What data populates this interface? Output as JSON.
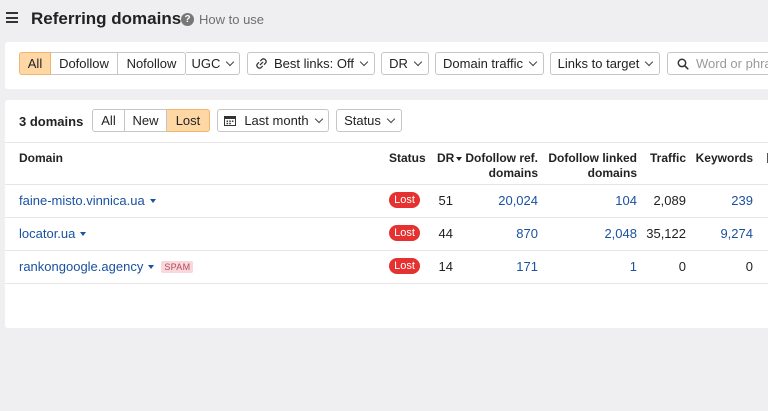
{
  "header": {
    "title": "Referring domains",
    "help_label": "How to use",
    "help_icon_glyph": "?"
  },
  "filters": {
    "link_type_tabs": [
      "All",
      "Dofollow",
      "Nofollow"
    ],
    "active_link_type": "All",
    "ugc_label": "UGC",
    "best_links_label": "Best links: Off",
    "dr_label": "DR",
    "domain_traffic_label": "Domain traffic",
    "links_to_target_label": "Links to target",
    "search_placeholder": "Word or phra"
  },
  "panel": {
    "count_label": "3 domains",
    "status_tabs": [
      "All",
      "New",
      "Lost"
    ],
    "active_status_tab": "Lost",
    "period_label": "Last month",
    "status_filter_label": "Status"
  },
  "table": {
    "columns": {
      "domain": "Domain",
      "status": "Status",
      "dr": "DR",
      "dofollow_ref_line1": "Dofollow ref.",
      "dofollow_ref_line2": "domains",
      "dofollow_linked_line1": "Dofollow linked",
      "dofollow_linked_line2": "domains",
      "traffic": "Traffic",
      "keywords": "Keywords"
    },
    "rows": [
      {
        "domain": "faine-misto.vinnica.ua",
        "spam": "",
        "status": "Lost",
        "dr": "51",
        "dofollow_ref": "20,024",
        "dofollow_linked": "104",
        "traffic": "2,089",
        "keywords": "239"
      },
      {
        "domain": "locator.ua",
        "spam": "",
        "status": "Lost",
        "dr": "44",
        "dofollow_ref": "870",
        "dofollow_linked": "2,048",
        "traffic": "35,122",
        "keywords": "9,274"
      },
      {
        "domain": "rankongoogle.agency",
        "spam": "SPAM",
        "status": "Lost",
        "dr": "14",
        "dofollow_ref": "171",
        "dofollow_linked": "1",
        "traffic": "0",
        "keywords": "0"
      }
    ]
  },
  "colors": {
    "active_tab_bg": "#fed7a5",
    "link": "#1a52a2",
    "lost_badge": "#e5312f",
    "spam_bg": "#f8d8dc"
  }
}
